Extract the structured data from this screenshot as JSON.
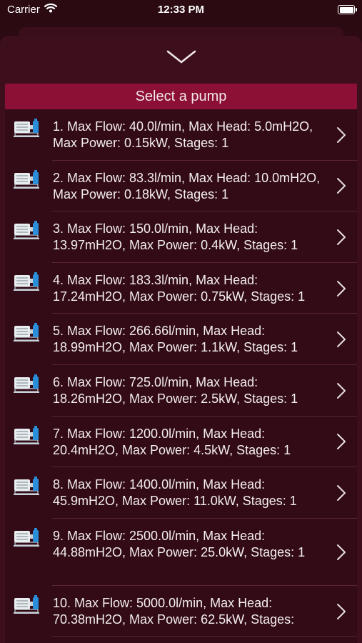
{
  "status": {
    "carrier": "Carrier",
    "time": "12:33 PM"
  },
  "header": {
    "title": "Select a pump"
  },
  "icons": {
    "dismiss": "chevron-down-icon",
    "row": "pump-icon",
    "disclosure": "chevron-right-icon"
  },
  "colors": {
    "background": "#2b0a12",
    "header": "#8c0f36",
    "list": "#320b16",
    "pump_icon": "#2a8fd8"
  },
  "pumps": [
    {
      "label": "1. Max Flow: 40.0l/min, Max Head: 5.0mH2O, Max Power: 0.15kW, Stages: 1"
    },
    {
      "label": "2. Max Flow: 83.3l/min, Max Head: 10.0mH2O, Max Power: 0.18kW, Stages: 1"
    },
    {
      "label": "3. Max Flow: 150.0l/min, Max Head: 13.97mH2O, Max Power: 0.4kW, Stages: 1"
    },
    {
      "label": "4. Max Flow: 183.3l/min, Max Head: 17.24mH2O, Max Power: 0.75kW, Stages: 1"
    },
    {
      "label": "5. Max Flow: 266.66l/min, Max Head: 18.99mH2O, Max Power: 1.1kW, Stages: 1"
    },
    {
      "label": "6. Max Flow: 725.0l/min, Max Head: 18.26mH2O, Max Power: 2.5kW, Stages: 1"
    },
    {
      "label": "7. Max Flow: 1200.0l/min, Max Head: 20.4mH2O, Max Power: 4.5kW, Stages: 1"
    },
    {
      "label": "8. Max Flow: 1400.0l/min, Max Head: 45.9mH2O, Max Power: 11.0kW, Stages: 1"
    },
    {
      "label": "9. Max Flow: 2500.0l/min, Max Head: 44.88mH2O, Max Power: 25.0kW, Stages: 1"
    },
    {
      "label": "10. Max Flow: 5000.0l/min, Max Head: 70.38mH2O, Max Power: 62.5kW, Stages:"
    }
  ]
}
